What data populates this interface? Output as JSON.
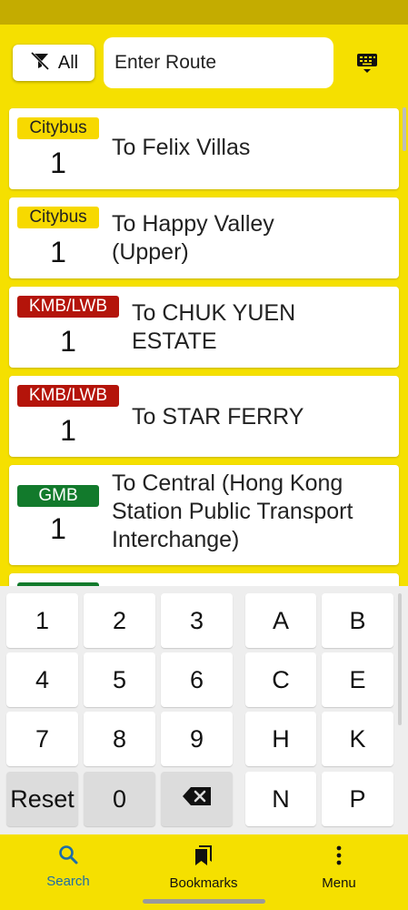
{
  "search": {
    "filter_label": "All",
    "input_value": "Enter Route"
  },
  "routes": [
    {
      "operator": "Citybus",
      "number": "1",
      "dest": [
        "To  Felix Villas"
      ]
    },
    {
      "operator": "Citybus",
      "number": "1",
      "dest": [
        "To  Happy Valley",
        "(Upper)"
      ]
    },
    {
      "operator": "KMB/LWB",
      "number": "1",
      "dest": [
        "To  CHUK YUEN",
        "ESTATE"
      ]
    },
    {
      "operator": "KMB/LWB",
      "number": "1",
      "dest": [
        "To  STAR FERRY"
      ]
    },
    {
      "operator": "GMB",
      "number": "1",
      "dest": [
        "To  Central (Hong Kong",
        "Station Public Transport",
        "Interchange)"
      ]
    }
  ],
  "keypad": {
    "digits": [
      "1",
      "2",
      "3",
      "4",
      "5",
      "6",
      "7",
      "8",
      "9",
      "Reset",
      "0"
    ],
    "letters": [
      "A",
      "B",
      "C",
      "E",
      "H",
      "K",
      "N",
      "P"
    ],
    "backspace_icon": "backspace-icon"
  },
  "nav": {
    "search": "Search",
    "bookmarks": "Bookmarks",
    "menu": "Menu"
  },
  "colors": {
    "background": "#f5e000",
    "citybus": "#f7d900",
    "kmb": "#b4140a",
    "gmb": "#127a2c",
    "active_nav": "#1e6ea8"
  }
}
